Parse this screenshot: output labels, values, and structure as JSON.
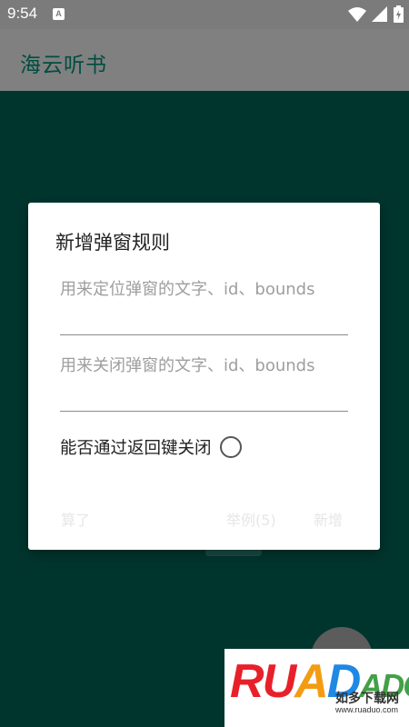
{
  "status_bar": {
    "time": "9:54",
    "notification_icon": "A"
  },
  "app_bar": {
    "title": "海云听书"
  },
  "dialog": {
    "title": "新增弹窗规则",
    "locate_field": {
      "value": "",
      "placeholder": "用来定位弹窗的文字、id、bounds"
    },
    "close_field": {
      "value": "",
      "placeholder": "用来关闭弹窗的文字、id、bounds"
    },
    "back_close": {
      "label": "能否通过返回键关闭",
      "checked": false
    },
    "buttons": {
      "cancel": "算了",
      "example": "举例(5)",
      "add": "新增"
    }
  },
  "watermark": {
    "brand": "RUANDADO",
    "brand_parts": [
      "R",
      "U",
      "A",
      "D",
      "ADO"
    ],
    "cn": "如多下载网",
    "url": "www.ruaduo.com"
  },
  "colors": {
    "status_bar": "#7b7b7b",
    "app_bar": "#808080",
    "title_text": "#004d40",
    "background": "#00352e",
    "dialog": "#ffffff"
  }
}
